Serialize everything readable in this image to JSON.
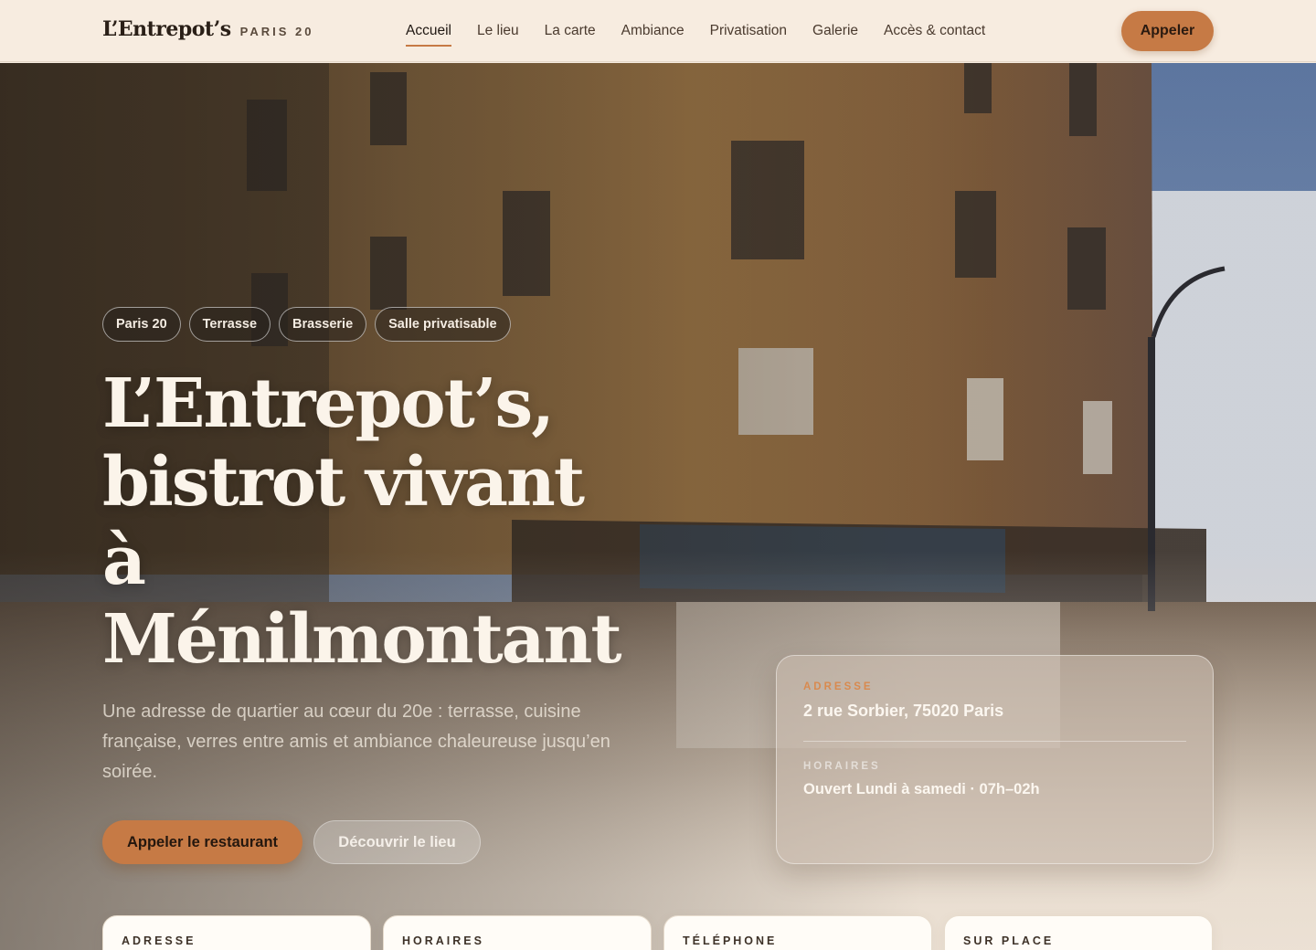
{
  "header": {
    "brand_name": "L’Entrepot’s",
    "brand_sub": "PARIS 20",
    "nav": [
      "Accueil",
      "Le lieu",
      "La carte",
      "Ambiance",
      "Privatisation",
      "Galerie",
      "Accès & contact"
    ],
    "active_nav": "Accueil",
    "call_label": "Appeler"
  },
  "hero": {
    "chips": [
      "Paris 20",
      "Terrasse",
      "Brasserie",
      "Salle privatisable"
    ],
    "title_line1": "L’Entrepot’s,",
    "title_line2": "bistrot vivant",
    "title_line3": "à",
    "title_line4": "Ménilmontant",
    "description": "Une adresse de quartier au cœur du 20e : terrasse, cuisine française, verres entre amis et ambiance chaleureuse jusqu’en soirée.",
    "primary_button": "Appeler le restaurant",
    "secondary_button": "Découvrir le lieu"
  },
  "info_card": {
    "address_label": "ADRESSE",
    "address_value": "2 rue Sorbier, 75020 Paris",
    "hours_label": "HORAIRES",
    "hours_value": "Ouvert Lundi à samedi · 07h–02h"
  },
  "cards": [
    "ADRESSE",
    "HORAIRES",
    "TÉLÉPHONE",
    "SUR PLACE"
  ],
  "colors": {
    "accent": "#c67a45",
    "background": "#f6ebde",
    "header_bg": "#f7ece0"
  }
}
